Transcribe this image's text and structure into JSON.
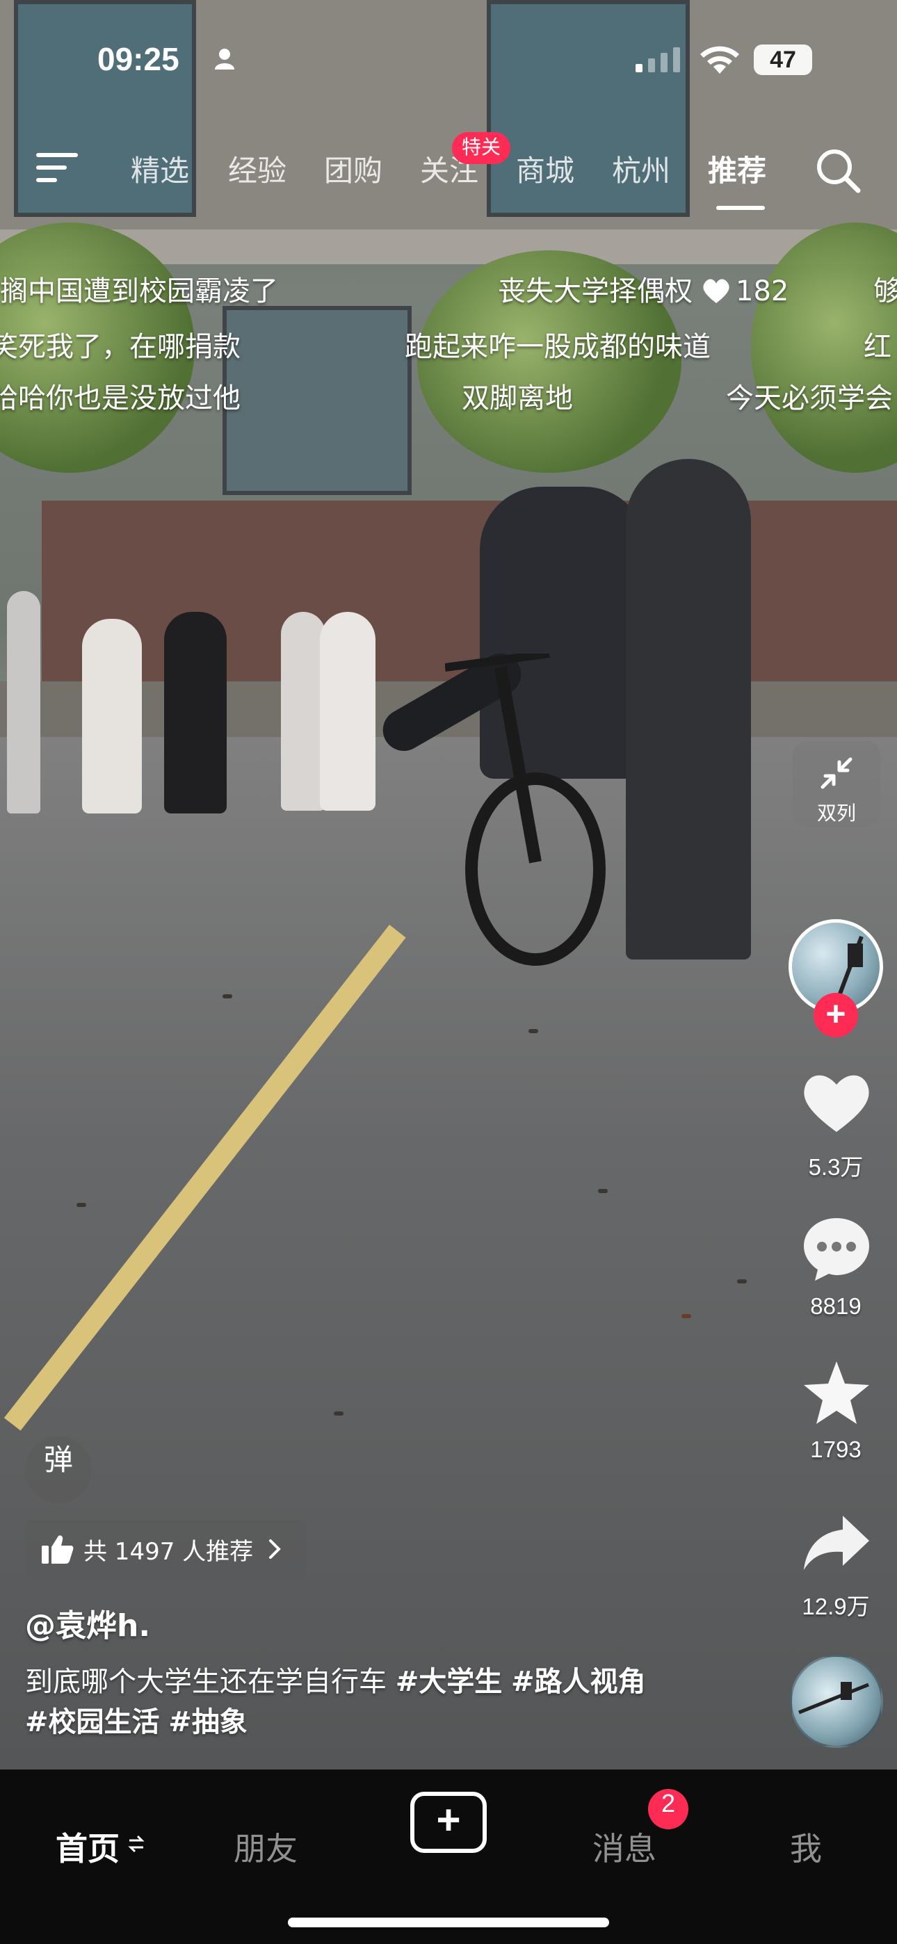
{
  "status_bar": {
    "time": "09:25",
    "battery": "47"
  },
  "top_nav": {
    "tabs": [
      {
        "label": "精选"
      },
      {
        "label": "经验"
      },
      {
        "label": "团购"
      },
      {
        "label": "关注"
      },
      {
        "label": "商城"
      },
      {
        "label": "杭州"
      },
      {
        "label": "推荐"
      }
    ],
    "active_tab": "推荐",
    "follow_badge": "特关"
  },
  "danmaku": {
    "row1": [
      "搁中国遭到校园霸凌了",
      "丧失大学择偶权",
      "182",
      "够"
    ],
    "row2": [
      "笑死我了，在哪捐款",
      "跑起来咋一股成都的味道",
      "红"
    ],
    "row3": [
      "哈哈你也是没放过他",
      "双脚离地",
      "今天必须学会"
    ]
  },
  "right_rail": {
    "dual_column_label": "双列",
    "likes": "5.3万",
    "comments": "8819",
    "favorites": "1793",
    "shares": "12.9万"
  },
  "video_info": {
    "danmaku_toggle": "弹",
    "recommend": "共 1497 人推荐",
    "author": "@袁烨h.",
    "caption": "到底哪个大学生还在学自行车",
    "hashtags": [
      "#大学生",
      "#路人视角",
      "#校园生活",
      "#抽象"
    ]
  },
  "tab_bar": {
    "home": "首页",
    "friends": "朋友",
    "messages": "消息",
    "messages_badge": "2",
    "me": "我"
  },
  "colors": {
    "accent": "#fe2c55",
    "tabbar_bg": "#0c0c0c"
  }
}
